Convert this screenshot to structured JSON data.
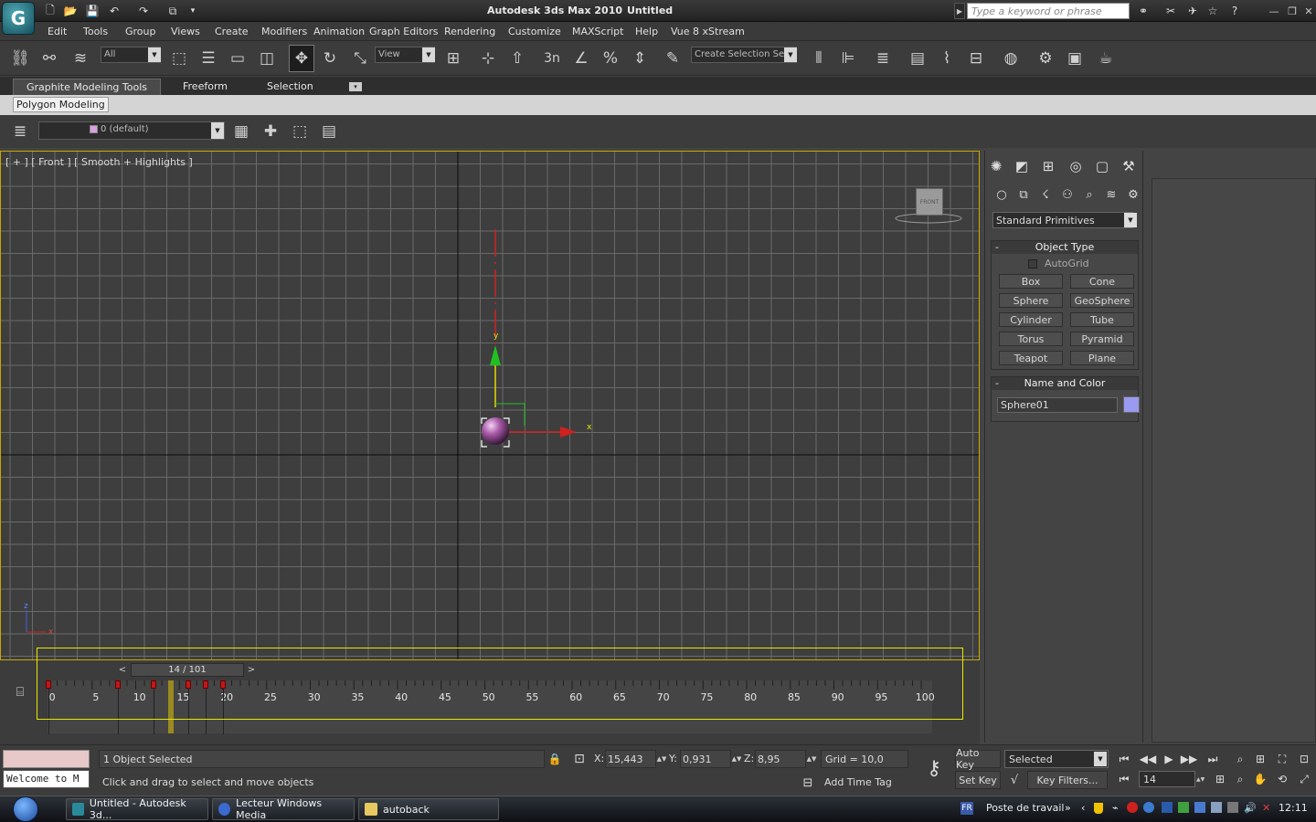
{
  "title": {
    "app": "Autodesk 3ds Max  2010",
    "document": "Untitled",
    "search_placeholder": "Type a keyword or phrase"
  },
  "menu": [
    "Edit",
    "Tools",
    "Group",
    "Views",
    "Create",
    "Modifiers",
    "Animation",
    "Graph Editors",
    "Rendering",
    "Customize",
    "MAXScript",
    "Help",
    "Vue 8 xStream"
  ],
  "toolbar": {
    "selection_filter": "All",
    "ref_coord": "View",
    "named_selection": "Create Selection Se",
    "snap_label": "3"
  },
  "ribbon": {
    "tabs": [
      "Graphite Modeling Tools",
      "Freeform",
      "Selection"
    ],
    "panel": "Polygon Modeling"
  },
  "layer": {
    "current": "0 (default)"
  },
  "viewport": {
    "label": "[ + ] [ Front ] [ Smooth + Highlights ]",
    "viewcube_label": "FRONT",
    "gizmo_y": "y",
    "gizmo_x": "x",
    "axis_z": "z",
    "axis_x": "x"
  },
  "command_panel": {
    "category": "Standard Primitives",
    "object_type_title": "Object Type",
    "autogrid": "AutoGrid",
    "buttons": [
      "Box",
      "Cone",
      "Sphere",
      "GeoSphere",
      "Cylinder",
      "Tube",
      "Torus",
      "Pyramid",
      "Teapot",
      "Plane"
    ],
    "name_color_title": "Name and Color",
    "object_name": "Sphere01",
    "object_color": "#9a9af0"
  },
  "timeline": {
    "slider": "14 / 101",
    "current_frame": 14,
    "total_frames": 100,
    "ticks": [
      "0",
      "5",
      "10",
      "15",
      "20",
      "25",
      "30",
      "35",
      "40",
      "45",
      "50",
      "55",
      "60",
      "65",
      "70",
      "75",
      "80",
      "85",
      "90",
      "95",
      "100"
    ],
    "keys": [
      0,
      8,
      12,
      16,
      18,
      20
    ]
  },
  "status": {
    "maxscript": "Welcome to M",
    "line1": "1 Object Selected",
    "line2": "Click and drag to select and move objects",
    "x_label": "X:",
    "x_value": "15,443",
    "y_label": "Y:",
    "y_value": "0,931",
    "z_label": "Z:",
    "z_value": "8,95",
    "grid": "Grid = 10,0",
    "add_time_tag": "Add Time Tag",
    "auto_key": "Auto Key",
    "set_key": "Set Key",
    "selected": "Selected",
    "key_filters": "Key Filters...",
    "frame": "14"
  },
  "taskbar": {
    "tasks": [
      "Untitled - Autodesk 3d...",
      "Lecteur Windows Media",
      "autoback"
    ],
    "lang": "FR",
    "tray_label": "Poste de travail",
    "clock": "12:11"
  }
}
